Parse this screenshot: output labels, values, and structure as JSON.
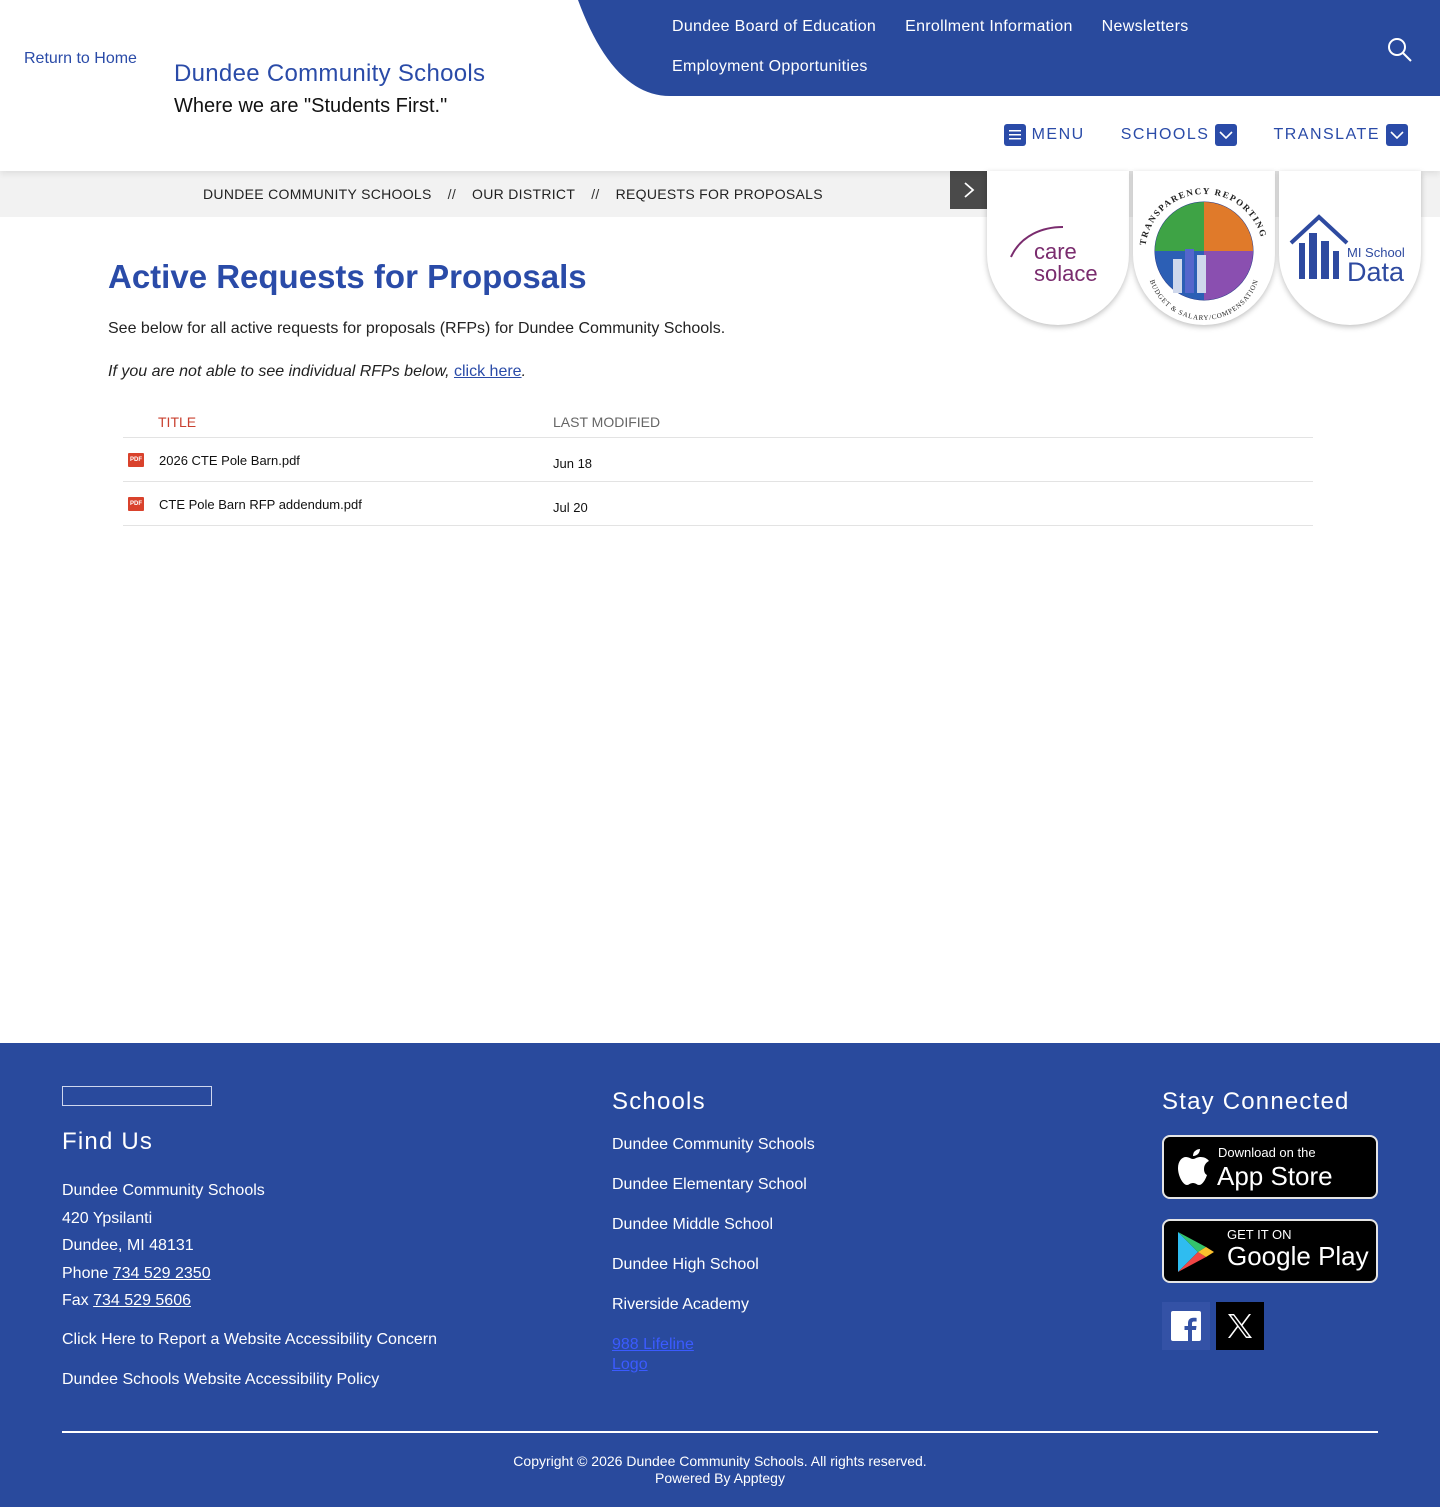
{
  "header": {
    "logo_alt": "Return to Home",
    "site_title": "Dundee Community Schools",
    "tagline": "Where we are \"Students First.\"",
    "utility_links": [
      "Dundee Board of Education",
      "Enrollment Information",
      "Newsletters",
      "Employment Opportunities"
    ],
    "nav": {
      "menu": "MENU",
      "schools": "SCHOOLS",
      "translate": "TRANSLATE"
    }
  },
  "breadcrumb": {
    "items": [
      "DUNDEE COMMUNITY SCHOOLS",
      "OUR DISTRICT",
      "REQUESTS FOR PROPOSALS"
    ],
    "separator": "//"
  },
  "badges": {
    "care_solace": {
      "line1": "care",
      "line2": "solace"
    },
    "transparency": {
      "top_text": "TRANSPARENCY REPORTING",
      "bottom_text": "BUDGET & SALARY/COMPENSATION"
    },
    "mi_school_data": {
      "line1": "MI School",
      "line2": "Data"
    }
  },
  "main": {
    "heading": "Active Requests for Proposals",
    "intro": "See below for all active requests for proposals (RFPs) for Dundee Community Schools.",
    "note_text": "If you are not able to see individual RFPs below, ",
    "note_link": "click here",
    "note_end": ".",
    "table": {
      "col_title": "TITLE",
      "col_modified": "LAST MODIFIED",
      "pdf_label": "PDF",
      "rows": [
        {
          "title": "2026 CTE Pole Barn.pdf",
          "modified": "Jun 18"
        },
        {
          "title": "CTE Pole Barn RFP addendum.pdf",
          "modified": "Jul 20"
        }
      ]
    }
  },
  "footer": {
    "find_us": {
      "heading": "Find Us",
      "name": "Dundee Community Schools",
      "street": "420 Ypsilanti",
      "city": "Dundee, MI 48131",
      "phone_label": "Phone ",
      "phone": "734 529 2350",
      "fax_label": "Fax ",
      "fax": "734 529 5606"
    },
    "accessibility_report": "Click Here to Report a Website Accessibility Concern",
    "accessibility_policy": "Dundee Schools Website Accessibility Policy",
    "schools_heading": "Schools",
    "schools": [
      "Dundee Community Schools",
      "Dundee Elementary School",
      "Dundee Middle School",
      "Dundee High School",
      "Riverside Academy"
    ],
    "lifeline_alt": "988 Lifeline Logo",
    "stay_connected": "Stay Connected",
    "app_store": {
      "small": "Download on the",
      "big": "App Store"
    },
    "google_play": {
      "small": "GET IT ON",
      "big": "Google Play"
    },
    "copyright": "Copyright © 2026 Dundee Community Schools. All rights reserved.",
    "powered": "Powered By Apptegy"
  },
  "colors": {
    "brand_blue": "#294a9d",
    "accent_red": "#c9402f"
  }
}
